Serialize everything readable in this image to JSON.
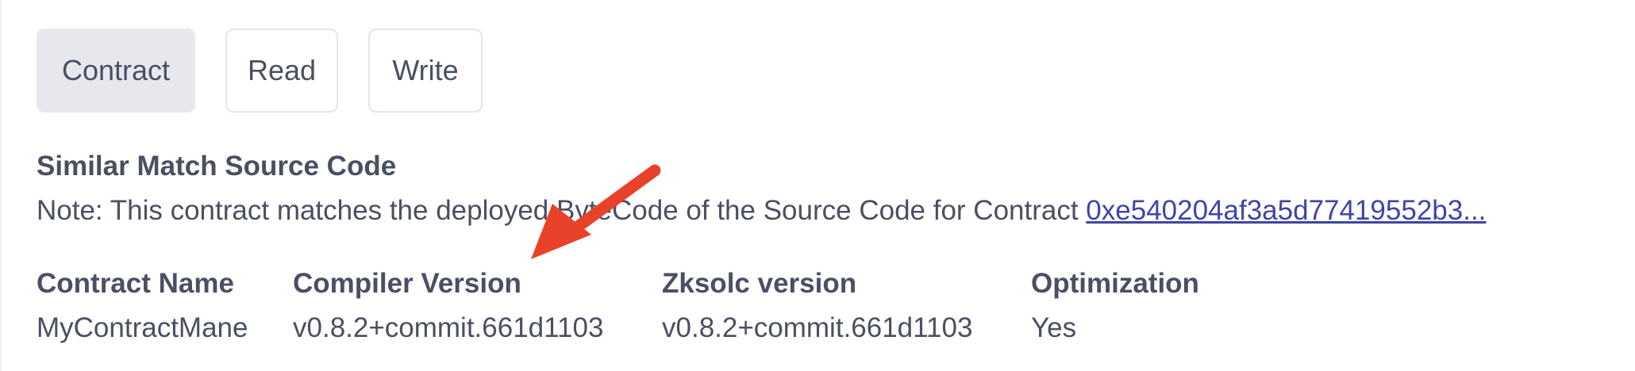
{
  "tabs": [
    {
      "label": "Contract",
      "active": true
    },
    {
      "label": "Read",
      "active": false
    },
    {
      "label": "Write",
      "active": false
    }
  ],
  "section": {
    "title": "Similar Match Source Code",
    "note_prefix": "Note: This contract matches the deployed ByteCode of the Source Code for Contract ",
    "note_link": "0xe540204af3a5d77419552b3..."
  },
  "details": {
    "contract_name": {
      "label": "Contract Name",
      "value": "MyContractMane"
    },
    "compiler_version": {
      "label": "Compiler Version",
      "value": "v0.8.2+commit.661d1103"
    },
    "zksolc_version": {
      "label": "Zksolc version",
      "value": "v0.8.2+commit.661d1103"
    },
    "optimization": {
      "label": "Optimization",
      "value": "Yes"
    }
  },
  "colors": {
    "text": "#4a4f63",
    "link": "#3f45a8",
    "active_tab_bg": "#e6e8ed",
    "annotation_arrow": "#e8432a"
  }
}
